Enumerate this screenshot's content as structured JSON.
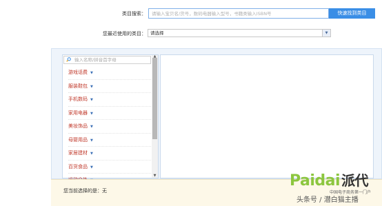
{
  "search": {
    "label": "类目搜索：",
    "placeholder": "请输入宝贝名/货号，数码电器输入型号，书籍类输入ISBN号",
    "button_label": "快速找到类目"
  },
  "recent": {
    "label": "您最近使用的类目：",
    "selected": "请选择",
    "arrow_icon": "chevron-down-icon"
  },
  "category_panel": {
    "filter_placeholder": "输入名称/拼音首字母",
    "filter_icon": "search-icon",
    "categories": [
      {
        "label": "游戏话费"
      },
      {
        "label": "服装鞋包"
      },
      {
        "label": "手机数码"
      },
      {
        "label": "家用电器"
      },
      {
        "label": "美妆饰品"
      },
      {
        "label": "母婴用品"
      },
      {
        "label": "家居建材"
      },
      {
        "label": "百货食品"
      },
      {
        "label": "运动户外"
      }
    ]
  },
  "footer": {
    "current_selection": "您当前选择的是：无"
  },
  "watermark": {
    "logo_text": "Paidai",
    "logo_cn": "派代",
    "tagline": "中国电子商务第一门户",
    "credit": "头条号 / 潜白猫主播"
  },
  "colors": {
    "accent": "#3a8ee6",
    "category_text": "#c0392b",
    "panel_bg": "#eef4fb",
    "footer_bg": "#fdf8e8",
    "logo_green": "#8cc63f"
  }
}
